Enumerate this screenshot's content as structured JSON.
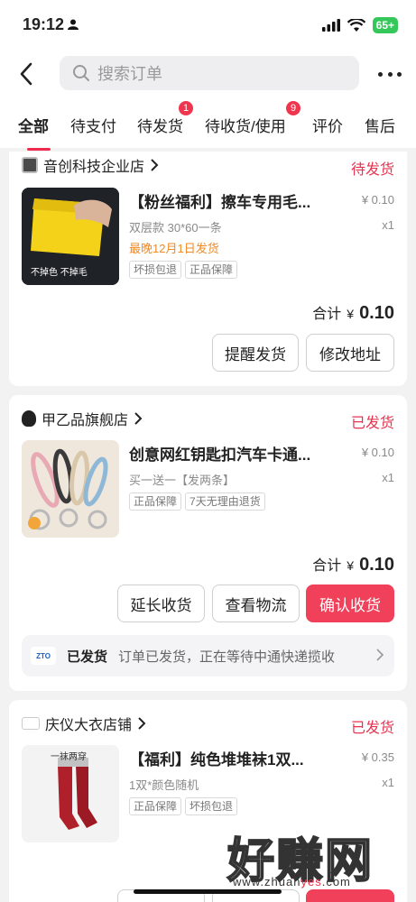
{
  "status_bar": {
    "time": "19:12",
    "battery": "65+"
  },
  "nav": {
    "search_placeholder": "搜索订单"
  },
  "tabs": [
    {
      "label": "全部",
      "badge": ""
    },
    {
      "label": "待支付",
      "badge": ""
    },
    {
      "label": "待发货",
      "badge": "1"
    },
    {
      "label": "待收货/使用",
      "badge": "9"
    },
    {
      "label": "评价",
      "badge": ""
    },
    {
      "label": "售后",
      "badge": ""
    }
  ],
  "orders": [
    {
      "shop": "音创科技企业店",
      "status": "待发货",
      "title": "【粉丝福利】擦车专用毛...",
      "price": "¥ 0.10",
      "spec": "双层款 30*60一条",
      "qty": "x1",
      "ship_note": "最晚12月1日发货",
      "tags": [
        "坏损包退",
        "正品保障"
      ],
      "thumb_caption": "不掉色 不掉毛",
      "total_label": "合计",
      "total_yen": "¥",
      "total_amount": "0.10",
      "buttons": [
        "提醒发货",
        "修改地址"
      ]
    },
    {
      "shop": "甲乙品旗舰店",
      "status": "已发货",
      "title": "创意网红钥匙扣汽车卡通...",
      "price": "¥ 0.10",
      "spec": "买一送一【发两条】",
      "qty": "x1",
      "tags": [
        "正品保障",
        "7天无理由退货"
      ],
      "total_label": "合计",
      "total_yen": "¥",
      "total_amount": "0.10",
      "buttons": [
        "延长收货",
        "查看物流",
        "确认收货"
      ],
      "logistics": {
        "logo_text": "ZTO",
        "status": "已发货",
        "message": "订单已发货，正在等待中通快递揽收"
      }
    },
    {
      "shop": "庆仪大衣店铺",
      "status": "已发货",
      "title": "【福利】纯色堆堆袜1双...",
      "price": "¥ 0.35",
      "spec": "1双*颜色随机",
      "qty": "x1",
      "tags": [
        "正品保障",
        "坏损包退"
      ],
      "thumb_caption": "一袜两穿"
    }
  ],
  "watermark": {
    "main": "好赚网",
    "url_prefix": "www.zhuan",
    "url_highlight": "yes",
    "url_suffix": ".com"
  },
  "colors": {
    "accent": "#f0405a",
    "status_red": "#e8334f",
    "ship_note_orange": "#f08a24",
    "battery_green": "#34c759"
  }
}
